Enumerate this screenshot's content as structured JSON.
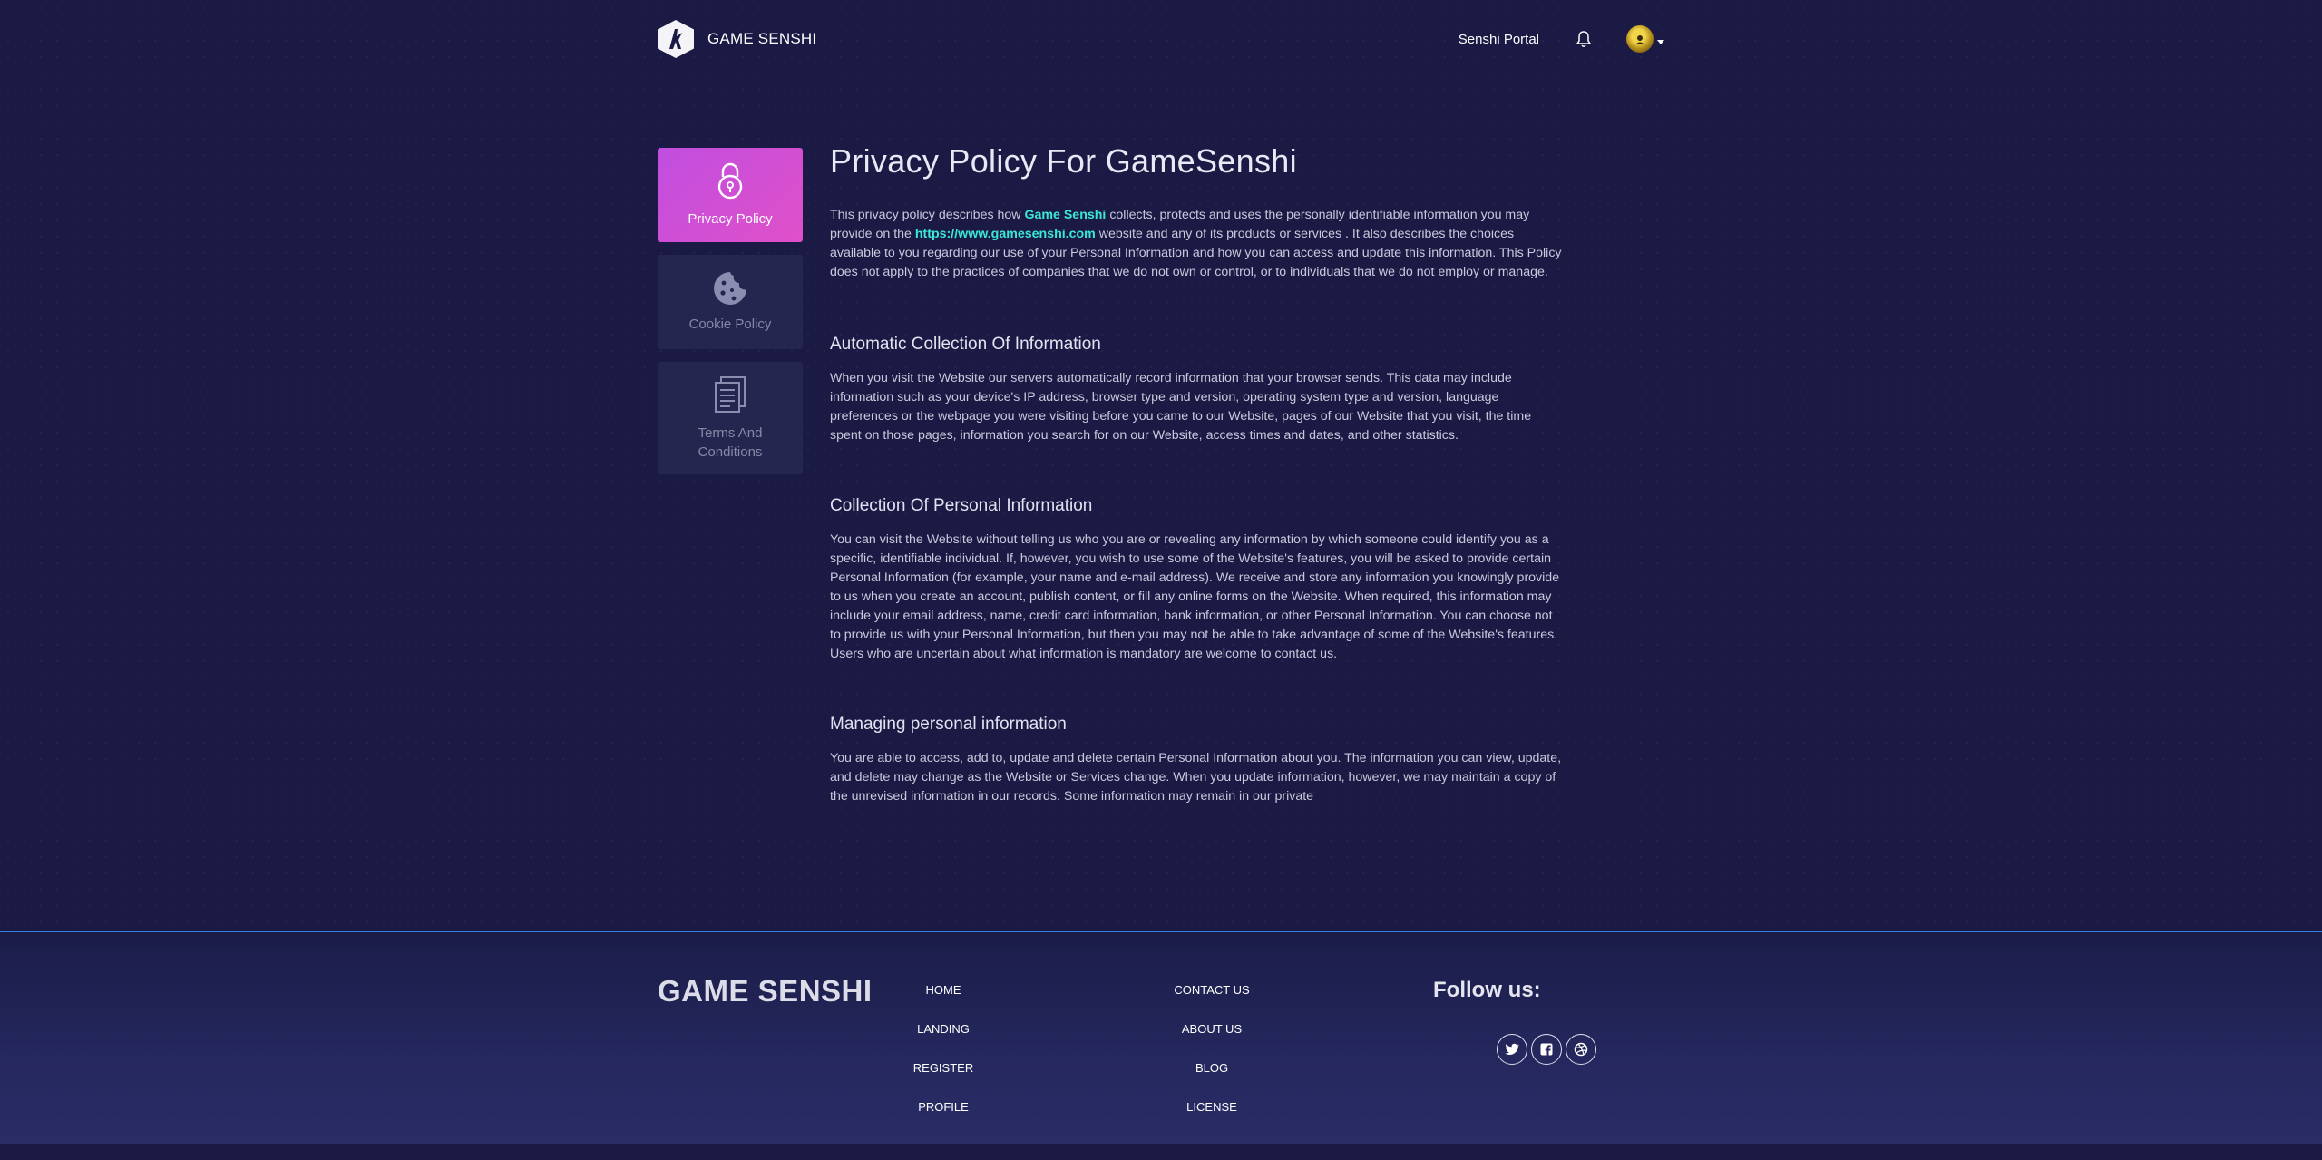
{
  "header": {
    "brand": "GAME SENSHI",
    "portal_link": "Senshi Portal"
  },
  "sidebar": {
    "items": [
      {
        "label": "Privacy Policy",
        "icon": "lock-icon",
        "active": true
      },
      {
        "label": "Cookie Policy",
        "icon": "cookie-icon",
        "active": false
      },
      {
        "label": "Terms And Conditions",
        "icon": "documents-icon",
        "active": false
      }
    ]
  },
  "main": {
    "title": "Privacy Policy For GameSenshi",
    "intro": {
      "part1": "This privacy policy describes how ",
      "brand_highlight": "Game Senshi",
      "part2": " collects, protects and uses the personally identifiable information you may provide on the ",
      "url": "https://www.gamesenshi.com",
      "part3": " website and any of its products or services . It also describes the choices available to you regarding our use of your Personal Information and how you can access and update this information. This Policy does not apply to the practices of companies that we do not own or control, or to individuals that we do not employ or manage."
    },
    "sections": [
      {
        "title": "Automatic Collection Of Information",
        "body": "When you visit the Website our servers automatically record information that your browser sends. This data may include information such as your device's IP address, browser type and version, operating system type and version, language preferences or the webpage you were visiting before you came to our Website, pages of our Website that you visit, the time spent on those pages, information you search for on our Website, access times and dates, and other statistics."
      },
      {
        "title": "Collection Of Personal Information",
        "body": "You can visit the Website without telling us who you are or revealing any information by which someone could identify you as a specific, identifiable individual. If, however, you wish to use some of the Website's features, you will be asked to provide certain Personal Information (for example, your name and e-mail address). We receive and store any information you knowingly provide to us when you create an account, publish content, or fill any online forms on the Website. When required, this information may include your email address, name, credit card information, bank information, or other Personal Information. You can choose not to provide us with your Personal Information, but then you may not be able to take advantage of some of the Website's features. Users who are uncertain about what information is mandatory are welcome to contact us."
      },
      {
        "title": "Managing personal information",
        "body": "You are able to access, add to, update and delete certain Personal Information about you. The information you can view, update, and delete may change as the Website or Services change. When you update information, however, we may maintain a copy of the unrevised information in our records. Some information may remain in our private"
      }
    ]
  },
  "footer": {
    "brand": "GAME SENSHI",
    "col1": [
      "HOME",
      "LANDING",
      "REGISTER",
      "PROFILE"
    ],
    "col2": [
      "CONTACT US",
      "ABOUT US",
      "BLOG",
      "LICENSE"
    ],
    "follow": "Follow us:",
    "socials": [
      "twitter-icon",
      "facebook-icon",
      "dribbble-icon"
    ]
  },
  "colors": {
    "background": "#1a1a44",
    "accent_gradient_start": "#c04ee0",
    "accent_gradient_end": "#e050c8",
    "highlight": "#3be8d8",
    "footer_line": "#2f7fe0"
  }
}
